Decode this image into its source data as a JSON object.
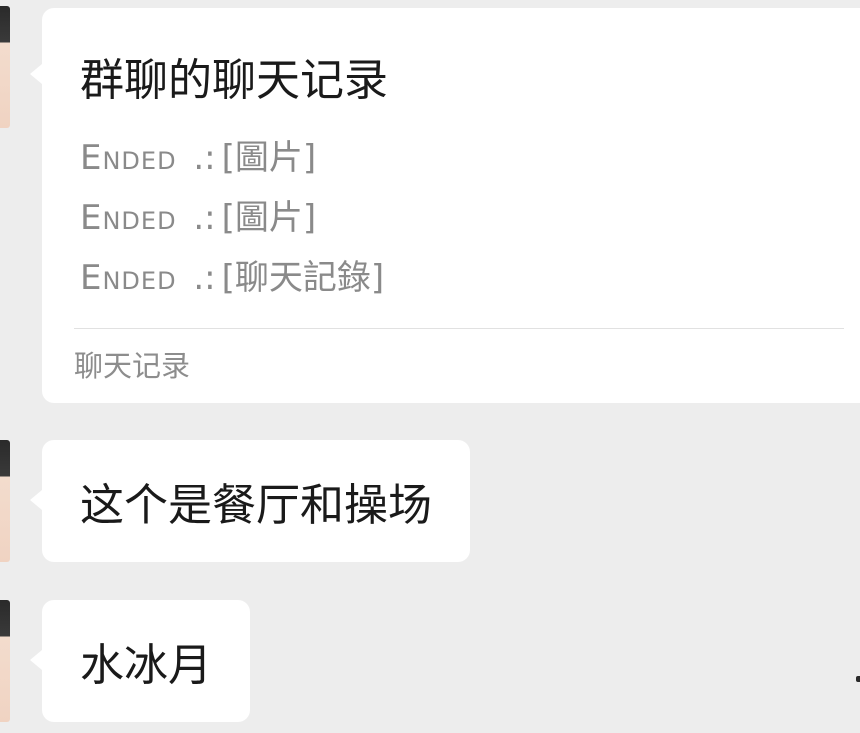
{
  "record_card": {
    "title": "群聊的聊天记录",
    "lines": [
      {
        "sender": "Ended",
        "separator": ".:",
        "content": "[圖片]"
      },
      {
        "sender": "Ended",
        "separator": ".:",
        "content": "[圖片]"
      },
      {
        "sender": "Ended",
        "separator": ".:",
        "content": "[聊天記錄]"
      }
    ],
    "footer": "聊天记录"
  },
  "messages": [
    {
      "text": "这个是餐厅和操场"
    },
    {
      "text": "水冰月"
    }
  ],
  "colors": {
    "background": "#ededed",
    "bubble": "#ffffff",
    "primary_text": "#1a1a1a",
    "secondary_text": "#8a8a8a"
  }
}
